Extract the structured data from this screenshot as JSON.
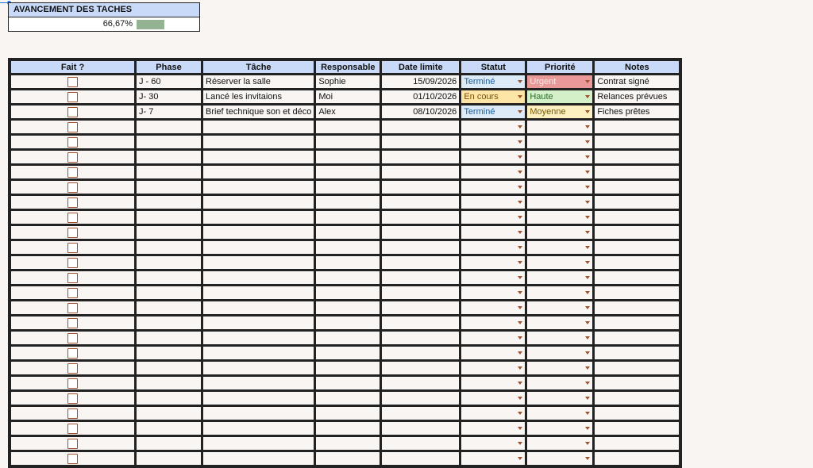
{
  "progress": {
    "title": "AVANCEMENT DES TACHES",
    "value_label": "66,67%",
    "fraction": 0.6667
  },
  "headers": [
    "Fait ?",
    "Phase",
    "Tâche",
    "Responsable",
    "Date limite",
    "Statut",
    "Priorité",
    "Notes"
  ],
  "rows": [
    {
      "phase": "J - 60",
      "task": "Réserver la salle",
      "owner": "Sophie",
      "date": "15/09/2026",
      "status": "Terminé",
      "status_class": "st-done",
      "priority": "Urgent",
      "priority_class": "pr-urgent",
      "notes": "Contrat signé"
    },
    {
      "phase": "J- 30",
      "task": "Lancé les invitaions",
      "owner": "Moi",
      "date": "01/10/2026",
      "status": "En cours",
      "status_class": "st-cours",
      "priority": "Haute",
      "priority_class": "pr-haute",
      "notes": "Relances prévues"
    },
    {
      "phase": "J- 7",
      "task": "Brief technique son et déco",
      "owner": "Alex",
      "date": "08/10/2026",
      "status": "Terminé",
      "status_class": "st-done",
      "priority": "Moyenne",
      "priority_class": "pr-moy",
      "notes": "Fiches prêtes"
    }
  ],
  "empty_row_count": 23,
  "colors": {
    "header_bg": "#c9daf8",
    "progress_fill": "#93b393",
    "checkbox_border": "#a0522d"
  }
}
